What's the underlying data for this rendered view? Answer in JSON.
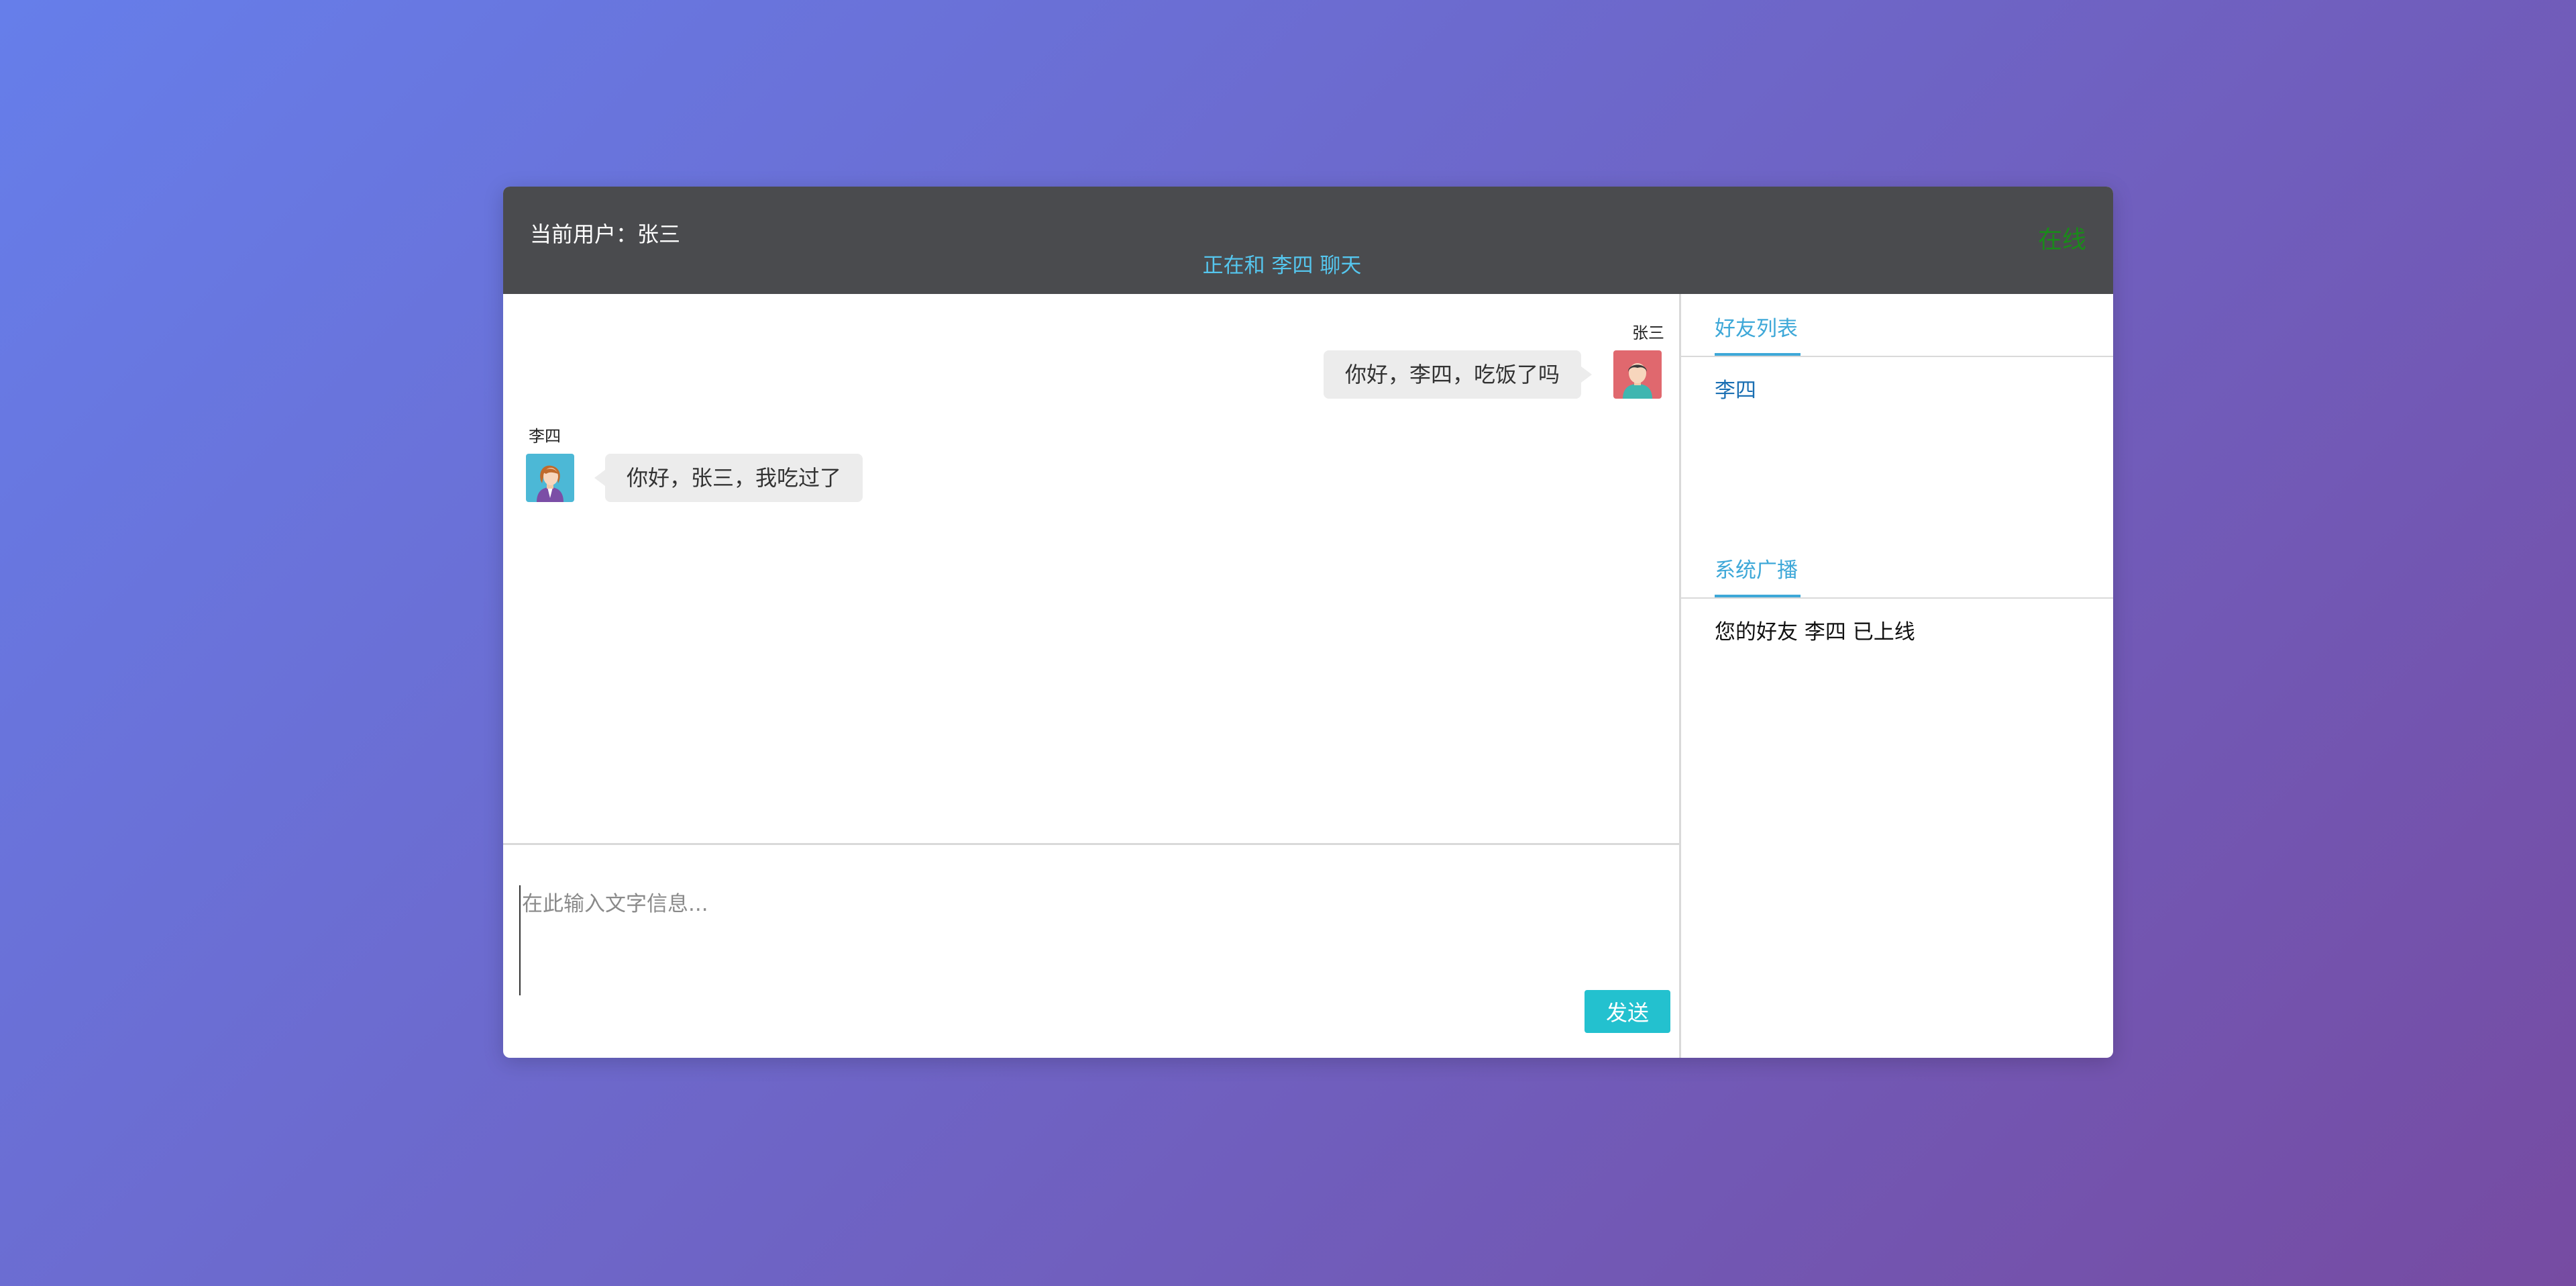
{
  "header": {
    "current_user_label": "当前用户：张三",
    "chatting_with_label": "正在和 李四 聊天",
    "online_status": "在线"
  },
  "messages": [
    {
      "sender": "张三",
      "text": "你好，李四，吃饭了吗",
      "side": "right",
      "avatar_icon": "male-user-avatar-icon"
    },
    {
      "sender": "李四",
      "text": "你好，张三，我吃过了",
      "side": "left",
      "avatar_icon": "female-user-avatar-icon"
    }
  ],
  "input": {
    "placeholder": "在此输入文字信息...",
    "value": "",
    "send_label": "发送"
  },
  "sidebar": {
    "friends_title": "好友列表",
    "friends": [
      "李四"
    ],
    "broadcast_title": "系统广播",
    "broadcasts": [
      "您的好友 李四 已上线"
    ]
  },
  "colors": {
    "header_bg": "#4a4b4e",
    "accent": "#3ea8d8",
    "send_button": "#23c1cf",
    "online": "#1a8a1a"
  }
}
